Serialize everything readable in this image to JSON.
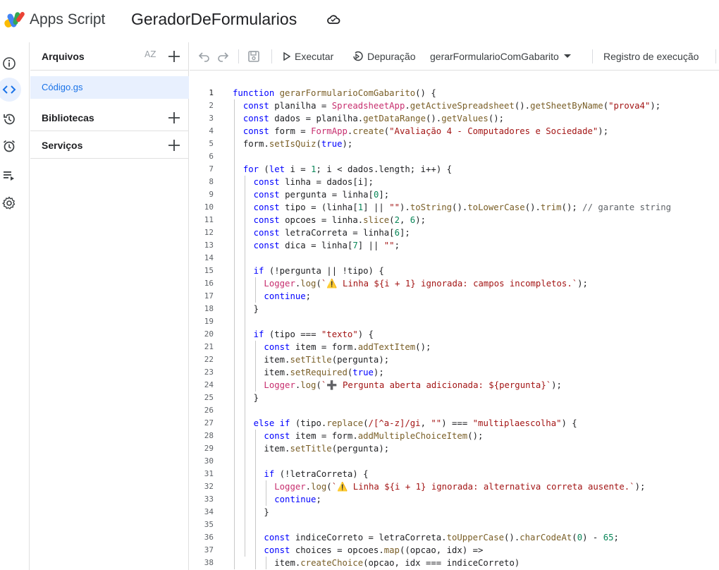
{
  "header": {
    "app_name": "Apps Script",
    "project_title": "GeradorDeFormularios"
  },
  "rail": {
    "items": [
      "overview",
      "editor",
      "triggers-history",
      "triggers",
      "executions",
      "settings"
    ]
  },
  "files": {
    "title": "Arquivos",
    "sort_label": "AZ",
    "file_name": "Código.gs",
    "libraries": "Bibliotecas",
    "services": "Serviços"
  },
  "toolbar": {
    "run": "Executar",
    "debug": "Depuração",
    "function_name": "gerarFormularioComGabarito",
    "log": "Registro de execução"
  },
  "colors": {
    "accent": "#1a73e8",
    "keyword": "#0000ff",
    "string": "#a31515",
    "class": "#c72e6e"
  },
  "editor": {
    "lines": [
      "function gerarFormularioComGabarito() {",
      "  const planilha = SpreadsheetApp.getActiveSpreadsheet().getSheetByName(\"prova4\");",
      "  const dados = planilha.getDataRange().getValues();",
      "  const form = FormApp.create(\"Avaliação 4 - Computadores e Sociedade\");",
      "  form.setIsQuiz(true);",
      "",
      "  for (let i = 1; i < dados.length; i++) {",
      "    const linha = dados[i];",
      "    const pergunta = linha[0];",
      "    const tipo = (linha[1] || \"\").toString().toLowerCase().trim(); // garante string",
      "    const opcoes = linha.slice(2, 6);",
      "    const letraCorreta = linha[6];",
      "    const dica = linha[7] || \"\";",
      "",
      "    if (!pergunta || !tipo) {",
      "      Logger.log(`⚠️ Linha ${i + 1} ignorada: campos incompletos.`);",
      "      continue;",
      "    }",
      "",
      "    if (tipo === \"texto\") {",
      "      const item = form.addTextItem();",
      "      item.setTitle(pergunta);",
      "      item.setRequired(true);",
      "      Logger.log(`➕ Pergunta aberta adicionada: ${pergunta}`);",
      "    }",
      "",
      "    else if (tipo.replace(/[^a-z]/gi, \"\") === \"multiplaescolha\") {",
      "      const item = form.addMultipleChoiceItem();",
      "      item.setTitle(pergunta);",
      "",
      "      if (!letraCorreta) {",
      "        Logger.log(`⚠️ Linha ${i + 1} ignorada: alternativa correta ausente.`);",
      "        continue;",
      "      }",
      "",
      "      const indiceCorreto = letraCorreta.toUpperCase().charCodeAt(0) - 65;",
      "      const choices = opcoes.map((opcao, idx) =>",
      "        item.createChoice(opcao, idx === indiceCorreto)"
    ]
  }
}
